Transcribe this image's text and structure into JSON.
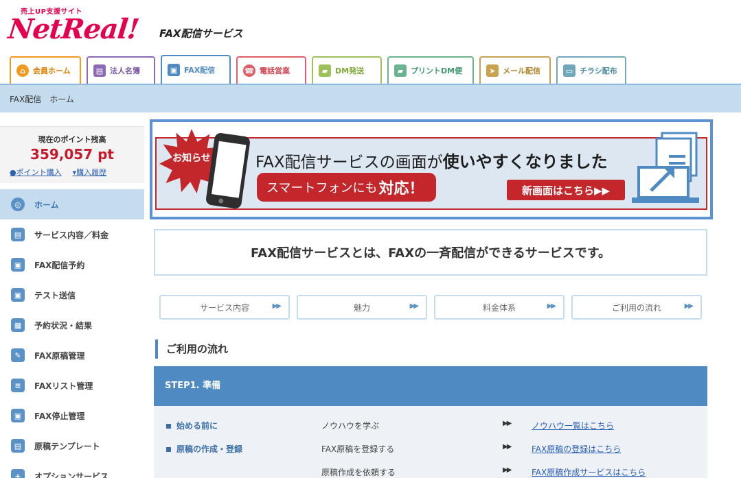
{
  "header": {
    "tagline": "売上UP支援サイト",
    "logo_text": "NetReal!",
    "service_title": "FAX配信サービス"
  },
  "tabs": [
    {
      "label": "会員ホーム",
      "icon": "home-icon"
    },
    {
      "label": "法人名簿",
      "icon": "book-icon"
    },
    {
      "label": "FAX配信",
      "icon": "fax-icon"
    },
    {
      "label": "電話営業",
      "icon": "operator-icon"
    },
    {
      "label": "DM発送",
      "icon": "truck-icon"
    },
    {
      "label": "プリントDM便",
      "icon": "print-truck-icon"
    },
    {
      "label": "メール配信",
      "icon": "paper-plane-icon"
    },
    {
      "label": "チラシ配布",
      "icon": "flyer-icon"
    }
  ],
  "breadcrumb": "FAX配信　ホーム",
  "sidebar": {
    "points_label": "現在のポイント残高",
    "points_value": "359,057 pt",
    "points_purchase": "ポイント購入",
    "points_history": "購入履歴",
    "items": [
      {
        "label": "ホーム",
        "icon": "globe-icon"
      },
      {
        "label": "サービス内容／料金",
        "icon": "document-icon"
      },
      {
        "label": "FAX配信予約",
        "icon": "fax-icon"
      },
      {
        "label": "テスト送信",
        "icon": "fax-icon"
      },
      {
        "label": "予約状況・結果",
        "icon": "calendar-icon"
      },
      {
        "label": "FAX原稿管理",
        "icon": "document-edit-icon"
      },
      {
        "label": "FAXリスト管理",
        "icon": "list-icon"
      },
      {
        "label": "FAX停止管理",
        "icon": "fax-stop-icon"
      },
      {
        "label": "原稿テンプレート",
        "icon": "template-icon"
      },
      {
        "label": "オプションサービス",
        "icon": "plus-circle-icon"
      }
    ]
  },
  "banner": {
    "badge": "お知らせ",
    "headline_normal": "FAX配信サービスの画面が",
    "headline_bold": "使いやすくなりました",
    "smartphone_text": "スマートフォンにも",
    "smartphone_bold": "対応！",
    "cta": "新画面はこちら▶▶",
    "colors": {
      "accent_red": "#c3262b",
      "frame_blue": "#5b92d1",
      "panel_bg": "#dde7f1"
    }
  },
  "lead_text": "FAX配信サービスとは、FAXの一斉配信ができるサービスです。",
  "subnav": [
    {
      "label": "サービス内容",
      "arrow": "▶▶"
    },
    {
      "label": "魅力",
      "arrow": "▶▶"
    },
    {
      "label": "料金体系",
      "arrow": "▶▶"
    },
    {
      "label": "ご利用の流れ",
      "arrow": "▶▶"
    }
  ],
  "flow": {
    "section_title": "ご利用の流れ",
    "step_title": "STEP1. 準備",
    "rows": [
      {
        "label": "始める前に",
        "desc": "ノウハウを学ぶ",
        "arrow": "▶▶",
        "link": "ノウハウ一覧はこちら"
      },
      {
        "label": "原稿の作成・登録",
        "desc": "FAX原稿を登録する",
        "arrow": "▶▶",
        "link": "FAX原稿の登録はこちら"
      },
      {
        "label": "",
        "desc": "原稿作成を依頼する",
        "arrow": "▶▶",
        "link": "FAX原稿作成サービスはこちら"
      }
    ]
  }
}
